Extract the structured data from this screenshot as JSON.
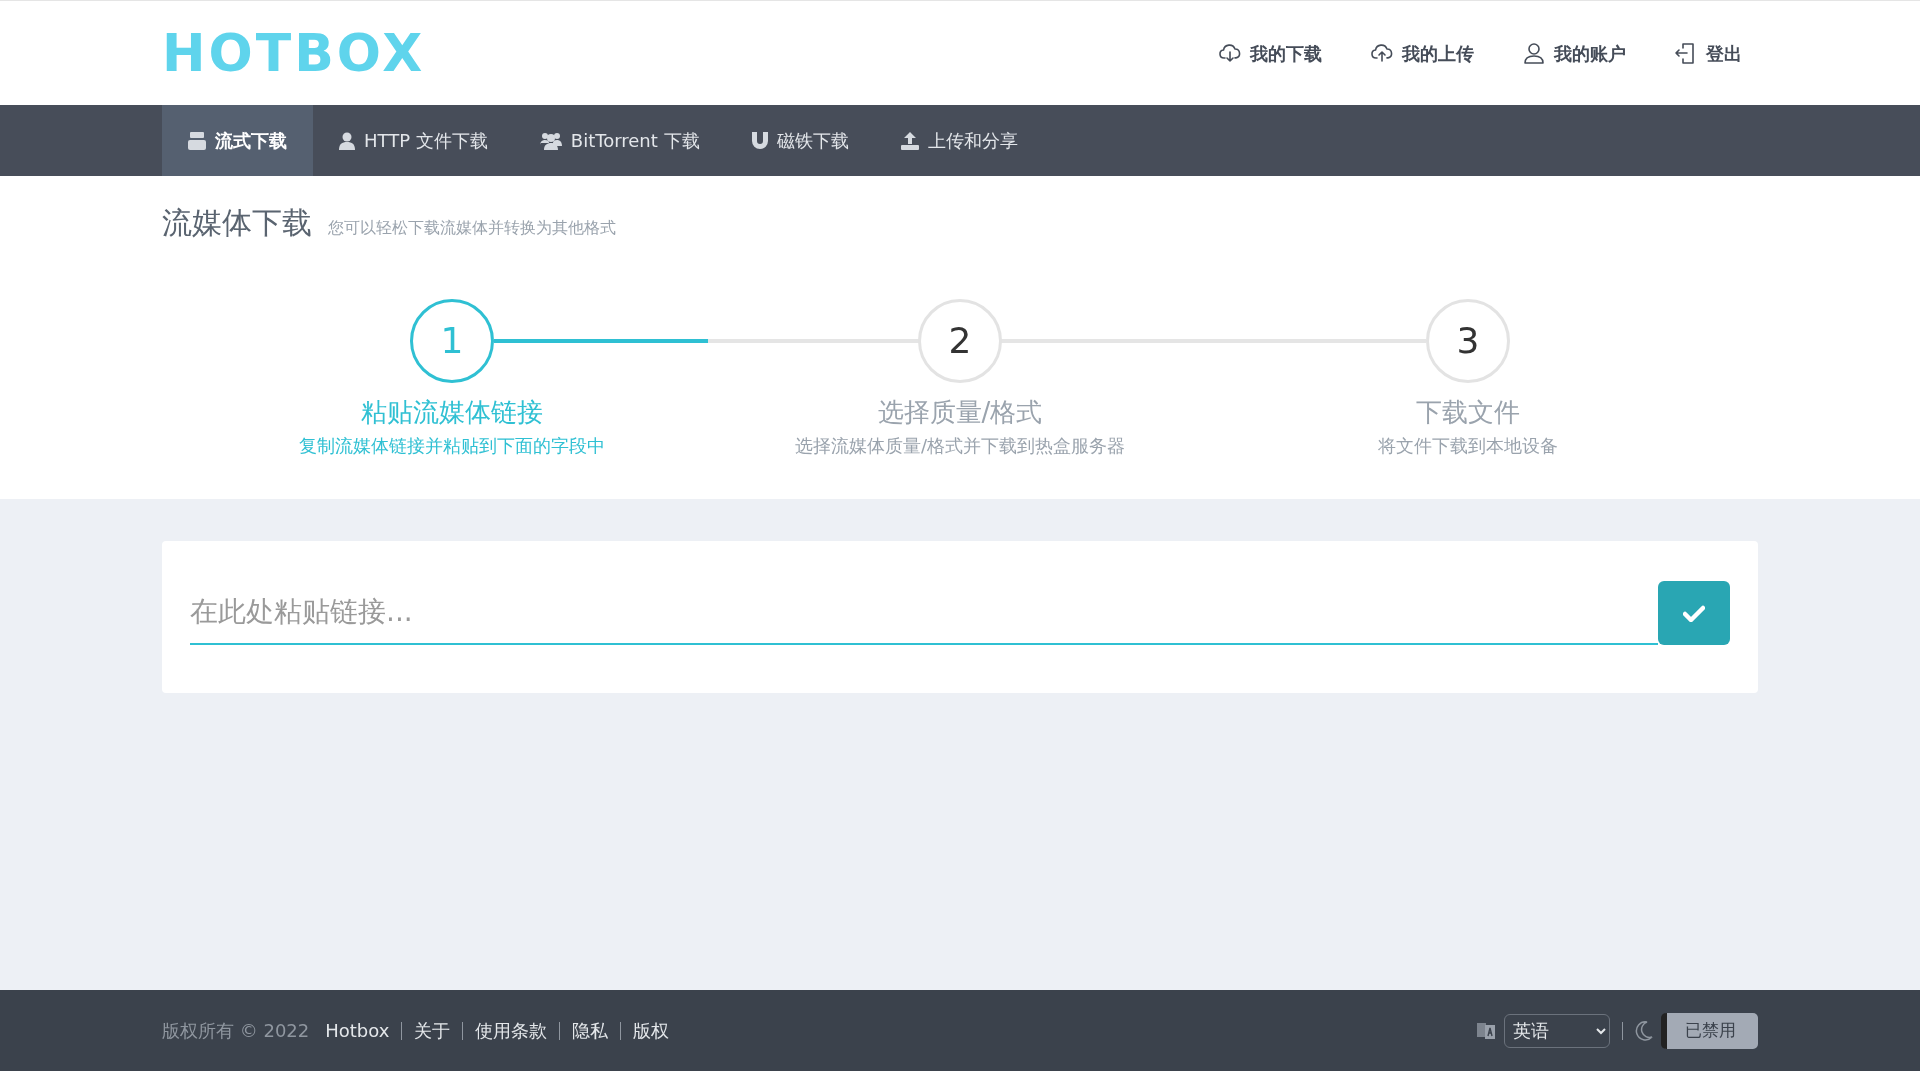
{
  "header": {
    "logo": "HOTBOX",
    "links": [
      {
        "label": "我的下载"
      },
      {
        "label": "我的上传"
      },
      {
        "label": "我的账户"
      },
      {
        "label": "登出"
      }
    ]
  },
  "tabs": [
    {
      "label": "流式下载",
      "selected": true
    },
    {
      "label": "HTTP 文件下载",
      "selected": false
    },
    {
      "label": "BitTorrent 下载",
      "selected": false
    },
    {
      "label": "磁铁下载",
      "selected": false
    },
    {
      "label": "上传和分享",
      "selected": false
    }
  ],
  "page": {
    "title": "流媒体下载",
    "subtitle": "您可以轻松下载流媒体并转换为其他格式"
  },
  "steps": [
    {
      "number": "1",
      "title": "粘贴流媒体链接",
      "description": "复制流媒体链接并粘贴到下面的字段中",
      "selected": true
    },
    {
      "number": "2",
      "title": "选择质量/格式",
      "description": "选择流媒体质量/格式并下载到热盒服务器",
      "selected": false
    },
    {
      "number": "3",
      "title": "下载文件",
      "description": "将文件下载到本地设备",
      "selected": false
    }
  ],
  "progress": {
    "level": 0.23
  },
  "link_form": {
    "placeholder": "在此处粘贴链接..."
  },
  "footer": {
    "copyright": "版权所有 © 2022",
    "brand": "Hotbox",
    "links": [
      "关于",
      "使用条款",
      "隐私",
      "版权"
    ],
    "language": "英语",
    "dark_mode": {
      "label": "已禁用",
      "on": false
    }
  }
}
